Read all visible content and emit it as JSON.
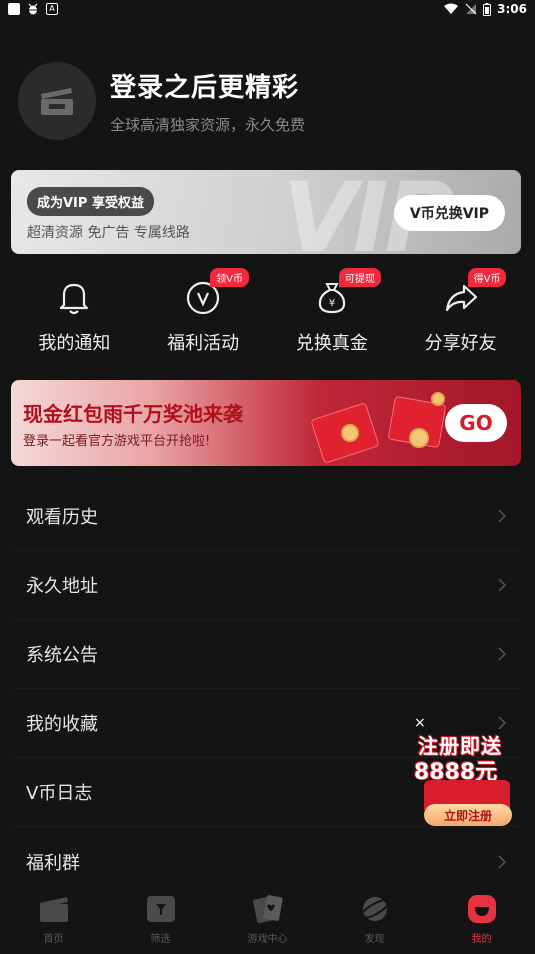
{
  "status_bar": {
    "time": "3:06",
    "badge_letter": "A"
  },
  "profile": {
    "title": "登录之后更精彩",
    "subtitle": "全球高清独家资源，永久免费"
  },
  "vip": {
    "tag": "成为VIP 享受权益",
    "perks": "超清资源  免广告  专属线路",
    "button": "V币兑换VIP",
    "watermark": "VIP"
  },
  "shortcuts": [
    {
      "label": "我的通知",
      "badge": "",
      "icon": "bell-icon"
    },
    {
      "label": "福利活动",
      "badge": "领V币",
      "icon": "v-coin-icon"
    },
    {
      "label": "兑换真金",
      "badge": "可提现",
      "icon": "money-bag-icon"
    },
    {
      "label": "分享好友",
      "badge": "得V币",
      "icon": "share-icon"
    }
  ],
  "banner": {
    "title": "现金红包雨千万奖池来袭",
    "subtitle": "登录一起看官方游戏平台开抢啦!",
    "button": "GO"
  },
  "menu": [
    {
      "label": "观看历史"
    },
    {
      "label": "永久地址"
    },
    {
      "label": "系统公告"
    },
    {
      "label": "我的收藏"
    },
    {
      "label": "V币日志"
    },
    {
      "label": "福利群"
    }
  ],
  "float_ad": {
    "close": "×",
    "line1": "注册即送",
    "line2": "8888元",
    "button": "立即注册"
  },
  "tabbar": [
    {
      "label": "首页",
      "icon": "clapperboard-icon",
      "active": false
    },
    {
      "label": "筛选",
      "icon": "filter-icon",
      "active": false
    },
    {
      "label": "游戏中心",
      "icon": "cards-icon",
      "active": false
    },
    {
      "label": "发现",
      "icon": "planet-icon",
      "active": false
    },
    {
      "label": "我的",
      "icon": "profile-icon",
      "active": true
    }
  ],
  "colors": {
    "accent": "#e53342",
    "background": "#141414",
    "badge": "#f02a3d"
  }
}
